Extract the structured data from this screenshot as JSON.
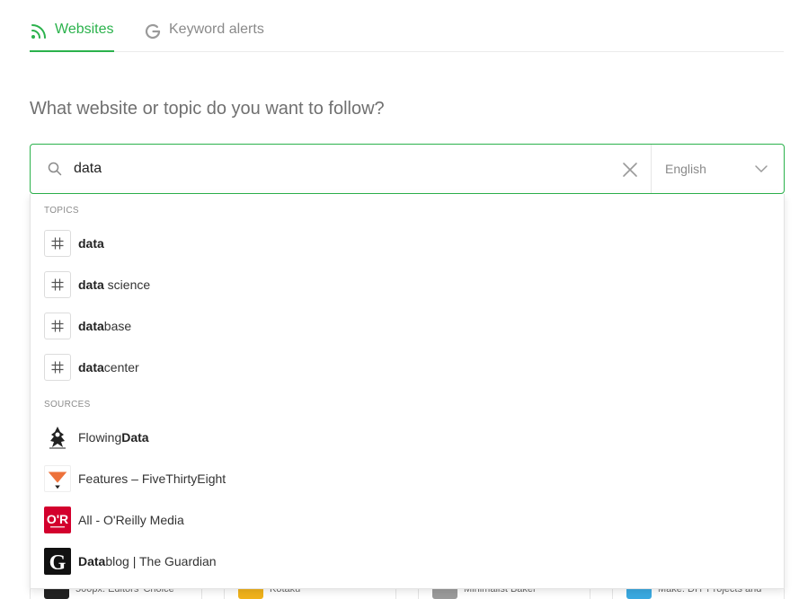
{
  "tabs": [
    {
      "label": "Websites",
      "active": true,
      "icon": "rss-icon"
    },
    {
      "label": "Keyword alerts",
      "active": false,
      "icon": "google-icon"
    }
  ],
  "question": "What website or topic do you want to follow?",
  "search": {
    "value": "data",
    "language": "English"
  },
  "dropdown": {
    "topics_label": "TOPICS",
    "topics": [
      {
        "bold": "data",
        "rest": ""
      },
      {
        "bold": "data",
        "rest": " science"
      },
      {
        "bold": "data",
        "rest": "base"
      },
      {
        "bold": "data",
        "rest": "center"
      }
    ],
    "sources_label": "SOURCES",
    "sources": [
      {
        "pre": "Flowing",
        "bold": "Data",
        "post": "",
        "logo": "flowingdata-logo"
      },
      {
        "pre": "Features – FiveThirtyEight",
        "bold": "",
        "post": "",
        "logo": "fivethirtyeight-logo"
      },
      {
        "pre": "All - O'Reilly Media",
        "bold": "",
        "post": "",
        "logo": "oreilly-logo"
      },
      {
        "pre": "",
        "bold": "Data",
        "post": "blog | The Guardian",
        "logo": "guardian-logo"
      }
    ]
  },
  "background_cards": [
    {
      "label": "500px: Editors' Choice"
    },
    {
      "label": "Kotaku"
    },
    {
      "label": "Minimalist Baker"
    },
    {
      "label": "Make: DIY Projects and"
    }
  ],
  "colors": {
    "accent": "#2bb24c",
    "oreilly": "#d3002d",
    "fivethirtyeight": "#ed713a"
  }
}
